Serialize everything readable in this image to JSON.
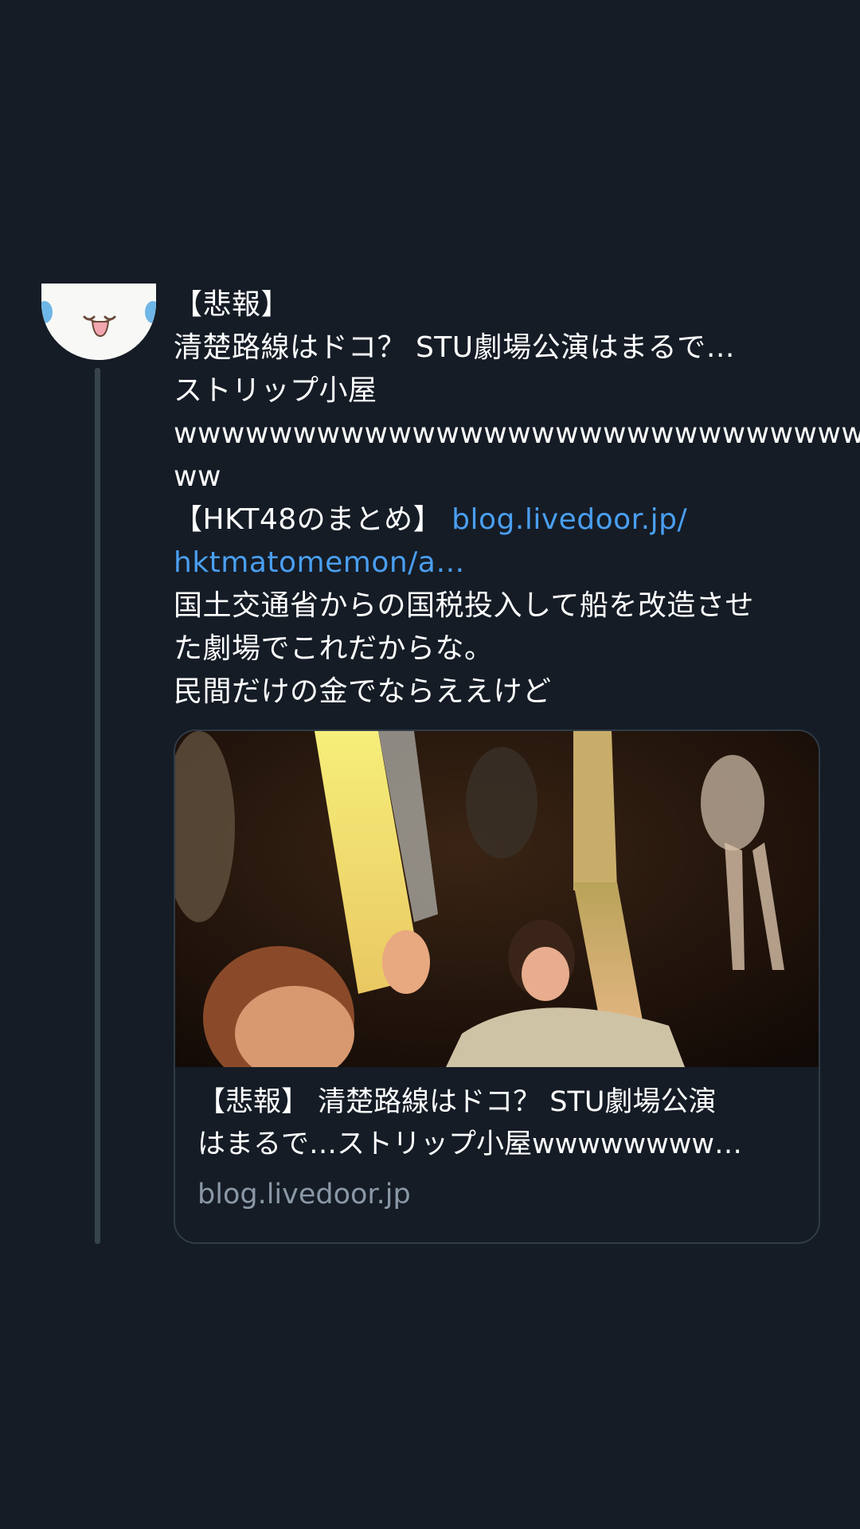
{
  "tweet": {
    "avatar_alt": "avatar",
    "lines": [
      "【悲報】",
      "清楚路線はドコ？ STU劇場公演はまるで…",
      "ストリップ小屋",
      "wwwwwwwwwwwwwwwwwwwwwwwwwwwwww",
      "ww"
    ],
    "tag": "【HKT48のまとめ】 ",
    "link_part1": "blog.livedoor.jp/",
    "link_part2": "hktmatomemon/a…",
    "comment_lines": [
      "国土交通省からの国税投入して船を改造させ",
      "た劇場でこれだからな。",
      "民間だけの金でならええけど"
    ]
  },
  "card": {
    "title_line1": "【悲報】 清楚路線はドコ？ STU劇場公演",
    "title_line2": "はまるで…ストリップ小屋wwwwwwww…",
    "domain": "blog.livedoor.jp"
  },
  "colors": {
    "background": "#151c26",
    "text": "#ffffff",
    "link": "#4a9ff1",
    "muted": "#8a98a6",
    "border": "#2f3b47",
    "thread_line": "#38444d"
  },
  "icons": {
    "avatar": "cartoon-face-avatar"
  }
}
